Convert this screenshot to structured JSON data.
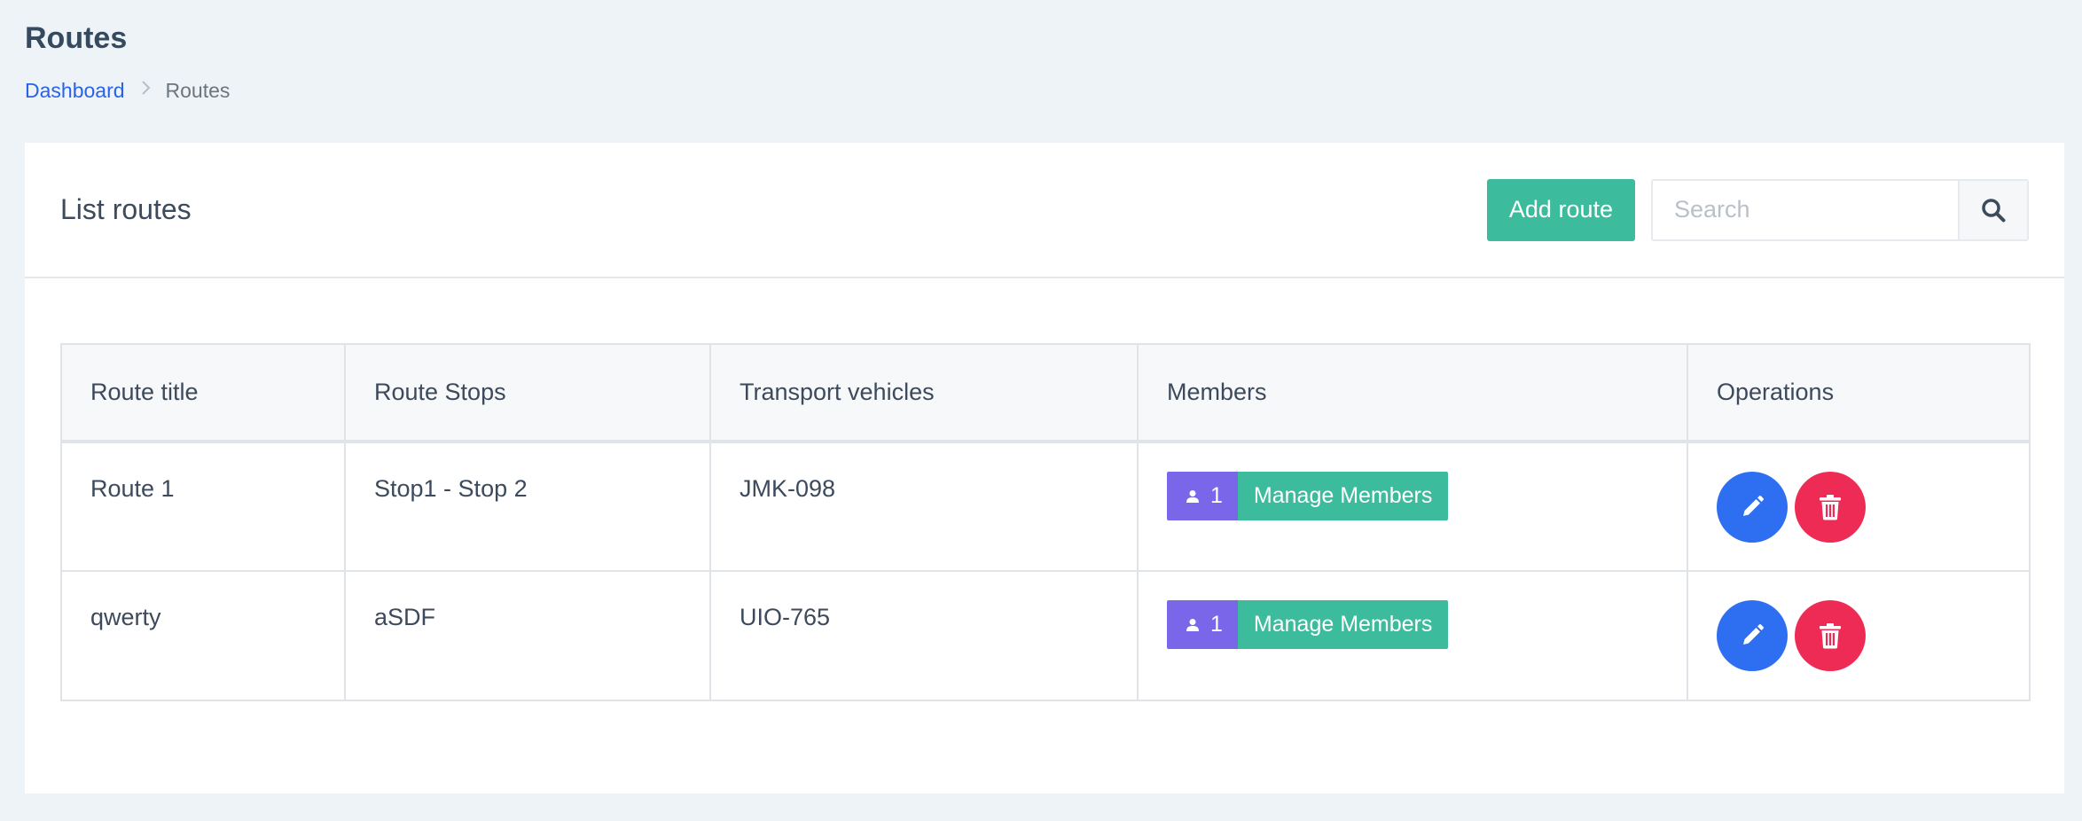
{
  "page": {
    "title": "Routes"
  },
  "breadcrumb": {
    "dashboard": "Dashboard",
    "current": "Routes"
  },
  "card": {
    "title": "List routes",
    "add_button": "Add route",
    "search_placeholder": "Search"
  },
  "table": {
    "headers": [
      "Route title",
      "Route Stops",
      "Transport vehicles",
      "Members",
      "Operations"
    ],
    "rows": [
      {
        "title": "Route 1",
        "stops": "Stop1 - Stop 2",
        "vehicles": "JMK-098",
        "member_count": "1",
        "manage_label": "Manage Members"
      },
      {
        "title": "qwerty",
        "stops": "aSDF",
        "vehicles": "UIO-765",
        "member_count": "1",
        "manage_label": "Manage Members"
      }
    ]
  },
  "icons": {
    "search": "search-icon",
    "user": "user-icon",
    "edit": "pencil-icon",
    "delete": "trash-icon"
  },
  "colors": {
    "primary_green": "#3cbb9d",
    "badge_purple": "#7a66e8",
    "edit_blue": "#2d6ff0",
    "delete_red": "#ee2b55",
    "link_blue": "#2a62e8"
  }
}
